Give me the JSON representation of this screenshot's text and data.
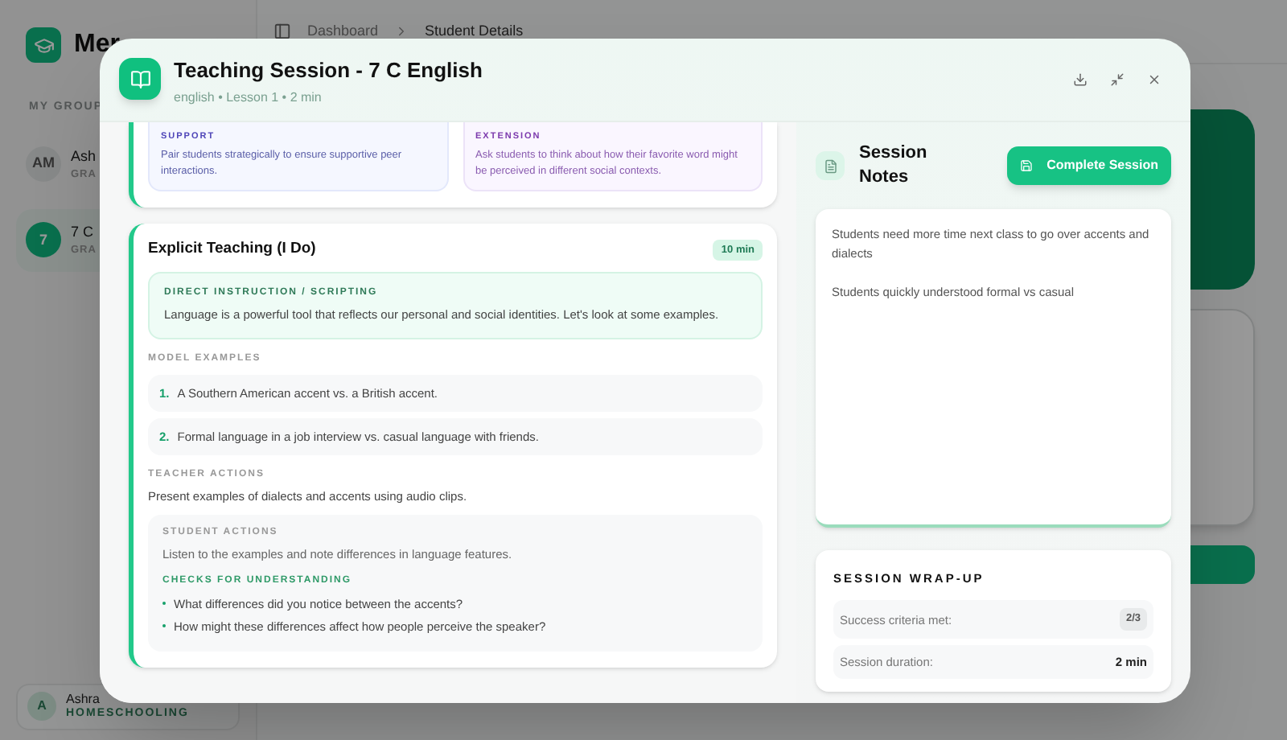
{
  "background": {
    "app_name": "Mer",
    "breadcrumb": [
      "Dashboard",
      "Student Details"
    ],
    "sidebar": {
      "section": "MY GROUP",
      "groups": [
        {
          "initials": "AM",
          "name": "Ash",
          "subtitle": "GRA",
          "selected": false
        },
        {
          "initials": "7",
          "name": "7 C",
          "subtitle": "GRA",
          "selected": true
        }
      ],
      "user": {
        "initial": "A",
        "name": "Ashra",
        "role": "HOMESCHOOLING"
      }
    }
  },
  "modal": {
    "title": "Teaching Session - 7 C English",
    "subtitle": "english • Lesson 1 • 2 min"
  },
  "differentiation": [
    {
      "kind": "support",
      "label": "SUPPORT",
      "text": "Pair students strategically to ensure supportive peer interactions."
    },
    {
      "kind": "extension",
      "label": "EXTENSION",
      "text": "Ask students to think about how their favorite word might be perceived in different social contexts."
    }
  ],
  "phase": {
    "title": "Explicit Teaching (I Do)",
    "duration": "10 min",
    "direct_instruction": {
      "label": "DIRECT INSTRUCTION / SCRIPTING",
      "text": "Language is a powerful tool that reflects our personal and social identities. Let's look at some examples."
    },
    "model_examples": {
      "label": "MODEL EXAMPLES",
      "items": [
        {
          "number": "1.",
          "text": "A Southern American accent vs. a British accent."
        },
        {
          "number": "2.",
          "text": "Formal language in a job interview vs. casual language with friends."
        }
      ]
    },
    "teacher_actions": {
      "label": "TEACHER ACTIONS",
      "text": "Present examples of dialects and accents using audio clips."
    },
    "student_actions": {
      "label": "STUDENT ACTIONS",
      "text": "Listen to the examples and note differences in language features."
    },
    "checks": {
      "label": "CHECKS FOR UNDERSTANDING",
      "items": [
        "What differences did you notice between the accents?",
        "How might these differences affect how people perceive the speaker?"
      ]
    }
  },
  "notes": {
    "title": "Session Notes",
    "button": "Complete Session",
    "value": "Students need more time next class to go over accents and dialects\n\nStudents quickly understood formal vs casual"
  },
  "wrap_up": {
    "title": "SESSION WRAP-UP",
    "rows": [
      {
        "kind": "badge",
        "label": "Success criteria met:",
        "value": "2/3"
      },
      {
        "kind": "plain",
        "label": "Session duration:",
        "value": "2 min"
      }
    ]
  }
}
